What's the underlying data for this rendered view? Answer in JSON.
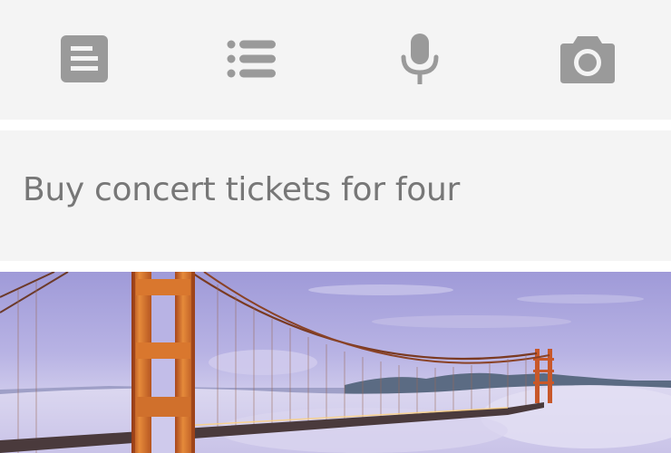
{
  "toolbar": {
    "items": [
      {
        "icon": "note-icon",
        "action": "text note"
      },
      {
        "icon": "list-icon",
        "action": "list note"
      },
      {
        "icon": "microphone-icon",
        "action": "voice note"
      },
      {
        "icon": "camera-icon",
        "action": "photo note"
      }
    ],
    "icon_color": "#9a9a9a",
    "background": "#f4f4f4"
  },
  "note": {
    "text": "Buy concert tickets for four"
  },
  "image_card": {
    "subject": "golden-gate-bridge-in-fog"
  }
}
